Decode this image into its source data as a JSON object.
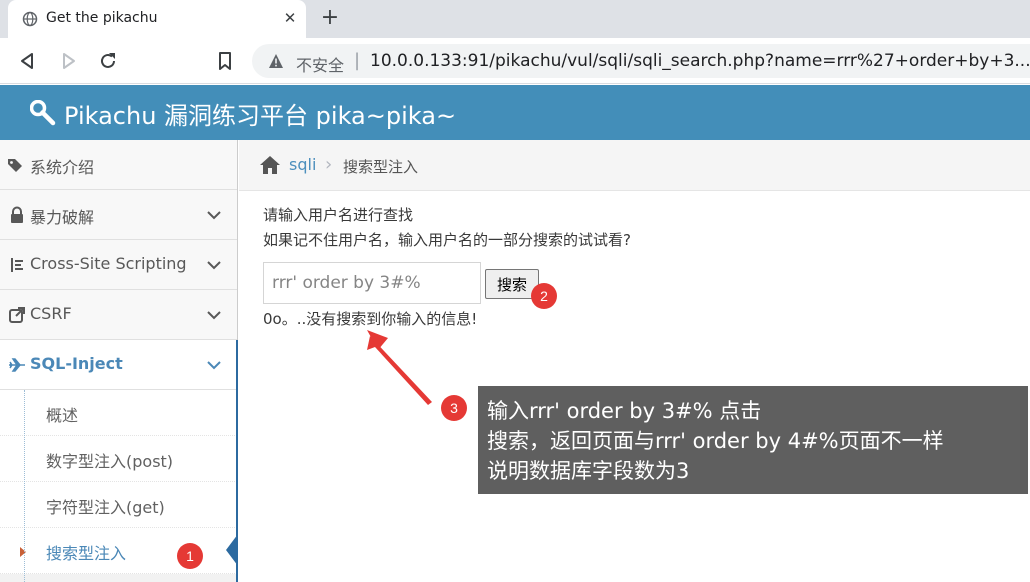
{
  "browser": {
    "tab_title": "Get the pikachu",
    "tab_close": "✕",
    "new_tab": "+",
    "insecure_label": "不安全",
    "separator": "|",
    "url": "10.0.0.133:91/pikachu/vul/sqli/sqli_search.php?name=rrr%27+order+by+3..."
  },
  "header": {
    "brand": "Pikachu 漏洞练习平台 pika~pika~"
  },
  "sidebar": {
    "items": [
      {
        "label": "系统介绍",
        "icon": "tags-icon"
      },
      {
        "label": "暴力破解",
        "icon": "lock-icon"
      },
      {
        "label": "Cross-Site Scripting",
        "icon": "list-icon"
      },
      {
        "label": "CSRF",
        "icon": "share-icon"
      },
      {
        "label": "SQL-Inject",
        "icon": "plane-icon"
      }
    ],
    "sub_items": [
      {
        "label": "概述"
      },
      {
        "label": "数字型注入(post)"
      },
      {
        "label": "字符型注入(get)"
      },
      {
        "label": "搜索型注入"
      }
    ]
  },
  "breadcrumb": {
    "link": "sqli",
    "sep": "›",
    "current": "搜索型注入"
  },
  "main": {
    "prompt_line1": "请输入用户名进行查找",
    "prompt_line2": "如果记不住用户名，输入用户名的一部分搜索的试试看?",
    "search_value": "rrr' order by 3#%",
    "search_button": "搜索",
    "result_text": "0o。..没有搜索到你输入的信息!"
  },
  "annotations": {
    "badge1": "1",
    "badge2": "2",
    "badge3": "3",
    "callout_line1": "输入rrr' order by 3#% 点击",
    "callout_line2": "搜索，返回页面与rrr' order by 4#%页面不一样",
    "callout_line3": "说明数据库字段数为3",
    "badge_color": "#e53935",
    "callout_bg": "#5f5f5f"
  },
  "colors": {
    "header_bg": "#438eb9",
    "active_link": "#4b88b7"
  }
}
